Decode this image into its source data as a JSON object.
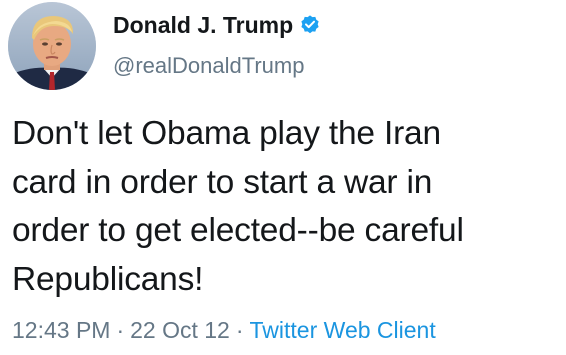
{
  "tweet": {
    "display_name": "Donald J. Trump",
    "handle": "@realDonaldTrump",
    "verified": true,
    "text": "Don't let Obama play the Iran\ncard in order to start a war in\norder to get elected--be careful\nRepublicans!",
    "time": "12:43 PM",
    "date": "22 Oct 12",
    "client": "Twitter Web Client",
    "separator": "·"
  },
  "colors": {
    "text": "#14171a",
    "secondary": "#657786",
    "link": "#1b95e0",
    "verified_badge": "#1da1f2"
  },
  "icons": {
    "avatar": "profile-photo",
    "verified": "verified-badge-icon"
  }
}
